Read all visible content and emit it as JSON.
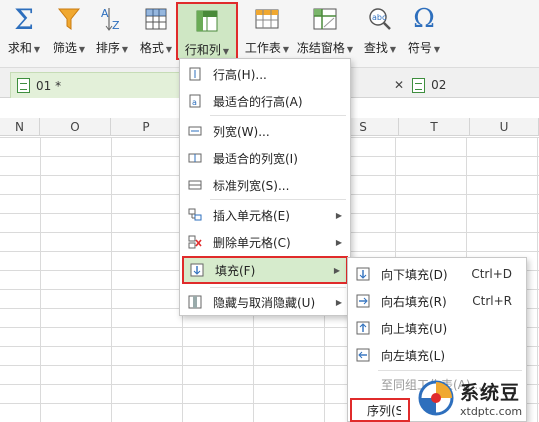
{
  "ribbon": {
    "buttons": [
      {
        "label": "求和",
        "icon": "sigma-icon"
      },
      {
        "label": "筛选",
        "icon": "filter-icon"
      },
      {
        "label": "排序",
        "icon": "sort-az-icon"
      },
      {
        "label": "格式",
        "icon": "format-table-icon"
      },
      {
        "label": "行和列",
        "icon": "rows-columns-icon"
      },
      {
        "label": "工作表",
        "icon": "worksheet-icon"
      },
      {
        "label": "冻结窗格",
        "icon": "freeze-panes-icon"
      },
      {
        "label": "查找",
        "icon": "find-icon"
      },
      {
        "label": "符号",
        "icon": "omega-icon"
      }
    ],
    "active_button": "行和列"
  },
  "tabs": [
    {
      "label": "01 *",
      "active": true
    },
    {
      "label": "02",
      "active": false
    }
  ],
  "columns": [
    "N",
    "O",
    "P",
    "S",
    "T",
    "U"
  ],
  "rows_cols_menu": {
    "items": [
      {
        "label": "行高(H)...",
        "icon": "row-height-icon"
      },
      {
        "label": "最适合的行高(A)",
        "icon": "autofit-row-icon"
      },
      {
        "label": "列宽(W)...",
        "icon": "column-width-icon"
      },
      {
        "label": "最适合的列宽(I)",
        "icon": "autofit-column-icon"
      },
      {
        "label": "标准列宽(S)...",
        "icon": "standard-width-icon"
      },
      {
        "label": "插入单元格(E)",
        "icon": "insert-cells-icon",
        "submenu": true
      },
      {
        "label": "删除单元格(C)",
        "icon": "delete-cells-icon",
        "submenu": true
      },
      {
        "label": "填充(F)",
        "icon": "fill-icon",
        "submenu": true,
        "selected": true
      },
      {
        "label": "隐藏与取消隐藏(U)",
        "icon": "hide-unhide-icon",
        "submenu": true
      }
    ]
  },
  "fill_submenu": {
    "items": [
      {
        "label": "向下填充(D)",
        "shortcut": "Ctrl+D",
        "icon": "fill-down-icon"
      },
      {
        "label": "向右填充(R)",
        "shortcut": "Ctrl+R",
        "icon": "fill-right-icon"
      },
      {
        "label": "向上填充(U)",
        "shortcut": "",
        "icon": "fill-up-icon"
      },
      {
        "label": "向左填充(L)",
        "shortcut": "",
        "icon": "fill-left-icon"
      },
      {
        "label": "至同组工作表(A)...",
        "shortcut": "",
        "icon": ""
      },
      {
        "label": "序列(S)...",
        "shortcut": "",
        "icon": ""
      }
    ]
  },
  "watermark": {
    "title": "系统豆",
    "url": "xtdptc.com"
  },
  "colors": {
    "accent_green": "#d6ebcc",
    "highlight_red": "#e02b2b"
  }
}
